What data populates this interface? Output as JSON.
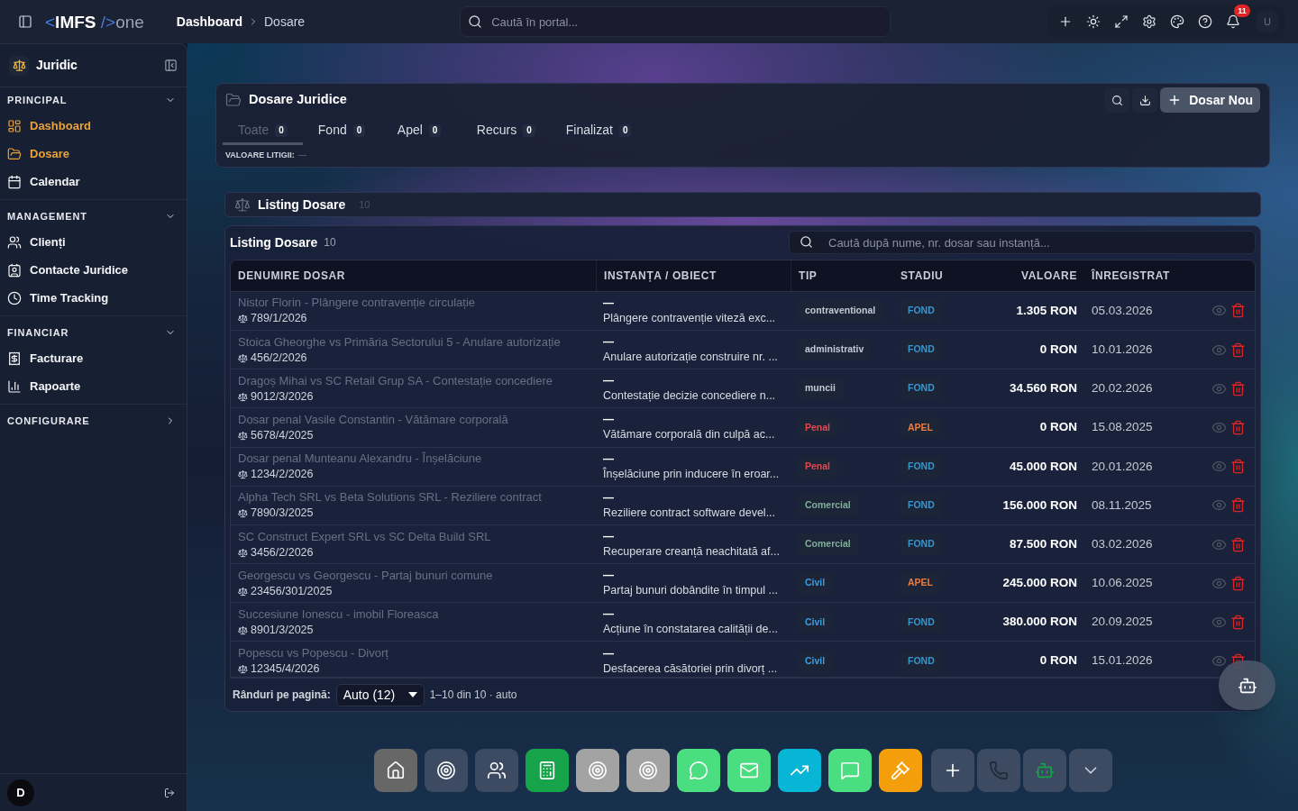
{
  "topbar": {
    "logo": {
      "open": "<",
      "name": "IMFS",
      "close": "/>",
      "suffix": "one"
    },
    "breadcrumb": [
      {
        "label": "Dashboard"
      },
      {
        "label": "Dosare"
      }
    ],
    "search": {
      "placeholder": "Caută în portal..."
    },
    "notifications": "11",
    "avatar": "U"
  },
  "sidebar": {
    "title": "Juridic",
    "sections": [
      {
        "label": "PRINCIPAL",
        "expanded": true,
        "items": [
          {
            "label": "Dashboard",
            "selected": true
          },
          {
            "label": "Dosare",
            "selected": true
          },
          {
            "label": "Calendar",
            "selected": false
          }
        ]
      },
      {
        "label": "MANAGEMENT",
        "expanded": true,
        "items": [
          {
            "label": "Clienți",
            "selected": false
          },
          {
            "label": "Contacte Juridice",
            "selected": false
          },
          {
            "label": "Time Tracking",
            "selected": false
          }
        ]
      },
      {
        "label": "FINANCIAR",
        "expanded": true,
        "items": [
          {
            "label": "Facturare",
            "selected": false
          },
          {
            "label": "Rapoarte",
            "selected": false
          }
        ]
      },
      {
        "label": "CONFIGURARE",
        "expanded": false
      }
    ],
    "avatar": "D"
  },
  "cases_panel": {
    "title": "Dosare Juridice",
    "new_button": "Dosar Nou",
    "tabs": [
      {
        "label": "Toate",
        "count": "0",
        "selected": true
      },
      {
        "label": "Fond",
        "count": "0",
        "selected": false
      },
      {
        "label": "Apel",
        "count": "0",
        "selected": false
      },
      {
        "label": "Recurs",
        "count": "0",
        "selected": false
      },
      {
        "label": "Finalizat",
        "count": "0",
        "selected": false
      }
    ],
    "summary": {
      "label": "VALOARE LITIGII:",
      "value": "—"
    }
  },
  "listing_bar": {
    "title": "Listing Dosare",
    "count": "10"
  },
  "listing": {
    "title": "Listing Dosare",
    "count": "10",
    "search": {
      "placeholder": "Caută după nume, nr. dosar sau instanță..."
    },
    "columns": [
      "DENUMIRE DOSAR",
      "INSTANȚA / OBIECT",
      "TIP",
      "STADIU",
      "VALOARE",
      "ÎNREGISTRAT"
    ],
    "rows": [
      {
        "name": "Nistor Florin - Plângere contravenție circulație",
        "number": "789/1/2026",
        "court": "—",
        "object": "Plângere contravenție viteză exc...",
        "type": {
          "label": "contraventional",
          "color": "#c3c8d2"
        },
        "stage": {
          "label": "FOND",
          "color": "#3a95cc"
        },
        "value": "1.305 RON",
        "registered": "05.03.2026"
      },
      {
        "name": "Stoica Gheorghe vs Primăria Sectorului 5 - Anulare autorizație",
        "number": "456/2/2026",
        "court": "—",
        "object": "Anulare autorizație construire nr. ...",
        "type": {
          "label": "administrativ",
          "color": "#c3c8d2"
        },
        "stage": {
          "label": "FOND",
          "color": "#3a95cc"
        },
        "value": "0 RON",
        "registered": "10.01.2026"
      },
      {
        "name": "Dragoș Mihai vs SC Retail Grup SA - Contestație concediere",
        "number": "9012/3/2026",
        "court": "—",
        "object": "Contestație decizie concediere n...",
        "type": {
          "label": "muncii",
          "color": "#c3c8d2"
        },
        "stage": {
          "label": "FOND",
          "color": "#3a95cc"
        },
        "value": "34.560 RON",
        "registered": "20.02.2026"
      },
      {
        "name": "Dosar penal Vasile Constantin - Vătămare corporală",
        "number": "5678/4/2025",
        "court": "—",
        "object": "Vătămare corporală din culpă ac...",
        "type": {
          "label": "Penal",
          "color": "#e5484d"
        },
        "stage": {
          "label": "APEL",
          "color": "#f07a3a"
        },
        "value": "0 RON",
        "registered": "15.08.2025"
      },
      {
        "name": "Dosar penal Munteanu Alexandru - Înșelăciune",
        "number": "1234/2/2026",
        "court": "—",
        "object": "Înșelăciune prin inducere în eroar...",
        "type": {
          "label": "Penal",
          "color": "#e5484d"
        },
        "stage": {
          "label": "FOND",
          "color": "#3a95cc"
        },
        "value": "45.000 RON",
        "registered": "20.01.2026"
      },
      {
        "name": "Alpha Tech SRL vs Beta Solutions SRL - Reziliere contract",
        "number": "7890/3/2025",
        "court": "—",
        "object": "Reziliere contract software devel...",
        "type": {
          "label": "Comercial",
          "color": "#7fae98"
        },
        "stage": {
          "label": "FOND",
          "color": "#3a95cc"
        },
        "value": "156.000 RON",
        "registered": "08.11.2025"
      },
      {
        "name": "SC Construct Expert SRL vs SC Delta Build SRL",
        "number": "3456/2/2026",
        "court": "—",
        "object": "Recuperare creanță neachitată af...",
        "type": {
          "label": "Comercial",
          "color": "#7fae98"
        },
        "stage": {
          "label": "FOND",
          "color": "#3a95cc"
        },
        "value": "87.500 RON",
        "registered": "03.02.2026"
      },
      {
        "name": "Georgescu vs Georgescu - Partaj bunuri comune",
        "number": "23456/301/2025",
        "court": "—",
        "object": "Partaj bunuri dobândite în timpul ...",
        "type": {
          "label": "Civil",
          "color": "#3b9ee0"
        },
        "stage": {
          "label": "APEL",
          "color": "#f07a3a"
        },
        "value": "245.000 RON",
        "registered": "10.06.2025"
      },
      {
        "name": "Succesiune Ionescu - imobil Floreasca",
        "number": "8901/3/2025",
        "court": "—",
        "object": "Acțiune în constatarea calității de...",
        "type": {
          "label": "Civil",
          "color": "#3b9ee0"
        },
        "stage": {
          "label": "FOND",
          "color": "#3a95cc"
        },
        "value": "380.000 RON",
        "registered": "20.09.2025"
      },
      {
        "name": "Popescu vs Popescu - Divorț",
        "number": "12345/4/2026",
        "court": "—",
        "object": "Desfacerea căsătoriei prin divorț ...",
        "type": {
          "label": "Civil",
          "color": "#3b9ee0"
        },
        "stage": {
          "label": "FOND",
          "color": "#3a95cc"
        },
        "value": "0 RON",
        "registered": "15.01.2026"
      }
    ],
    "pagination": {
      "label": "Rânduri pe pagină:",
      "page_size": "Auto (12)",
      "range": "1–10 din 10 · auto"
    }
  },
  "dock": {
    "apps": [
      {
        "color": "#676767"
      },
      {
        "color": "#3c4a62"
      },
      {
        "color": "#3c4a62"
      },
      {
        "color": "#17a34a"
      },
      {
        "color": "#a3a3a3"
      },
      {
        "color": "#a3a3a3"
      },
      {
        "color": "#4ade80"
      },
      {
        "color": "#4ade80"
      },
      {
        "color": "#06b6d4"
      },
      {
        "color": "#4ade80"
      },
      {
        "color": "#f59e0b"
      }
    ],
    "actions": [
      {
        "color": "#3c4a62"
      },
      {
        "color": "#3c4a62"
      },
      {
        "color": "#3c4a62"
      },
      {
        "color": "#3c4a62"
      }
    ]
  }
}
